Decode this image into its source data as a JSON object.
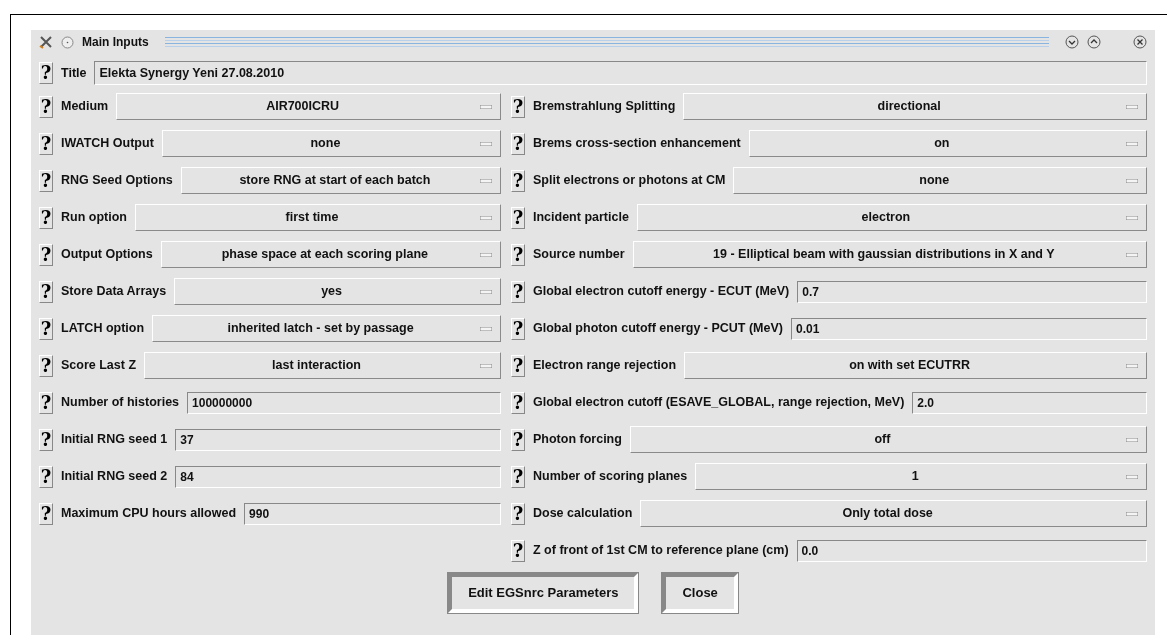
{
  "window": {
    "title": "Main Inputs"
  },
  "title_field": {
    "label": "Title",
    "value": "Elekta Synergy Yeni 27.08.2010"
  },
  "left_fields": [
    {
      "label": "Medium",
      "kind": "menu",
      "value": "AIR700ICRU"
    },
    {
      "label": "IWATCH Output",
      "kind": "menu",
      "value": "none"
    },
    {
      "label": "RNG Seed Options",
      "kind": "menu",
      "value": "store RNG at start of each batch"
    },
    {
      "label": "Run option",
      "kind": "menu",
      "value": "first time"
    },
    {
      "label": "Output Options",
      "kind": "menu",
      "value": "phase space at each scoring plane"
    },
    {
      "label": "Store Data Arrays",
      "kind": "menu",
      "value": "yes"
    },
    {
      "label": "LATCH option",
      "kind": "menu",
      "value": "inherited latch - set by passage"
    },
    {
      "label": "Score Last Z",
      "kind": "menu",
      "value": "last interaction"
    },
    {
      "label": "Number of histories",
      "kind": "entry",
      "value": "100000000"
    },
    {
      "label": "Initial RNG seed 1",
      "kind": "entry",
      "value": "37"
    },
    {
      "label": "Initial RNG seed 2",
      "kind": "entry",
      "value": "84"
    },
    {
      "label": "Maximum CPU hours allowed",
      "kind": "entry",
      "value": "990"
    }
  ],
  "right_fields": [
    {
      "label": "Bremstrahlung Splitting",
      "kind": "menu",
      "value": "directional"
    },
    {
      "label": "Brems cross-section enhancement",
      "kind": "menu",
      "value": "on"
    },
    {
      "label": "Split electrons or photons at CM",
      "kind": "menu",
      "value": "none"
    },
    {
      "label": "Incident particle",
      "kind": "menu",
      "value": "electron"
    },
    {
      "label": "Source number",
      "kind": "menu",
      "value": "19 - Elliptical beam with gaussian distributions in X and Y"
    },
    {
      "label": "Global electron cutoff energy - ECUT (MeV)",
      "kind": "entry",
      "value": "0.7"
    },
    {
      "label": "Global photon cutoff energy - PCUT (MeV)",
      "kind": "entry",
      "value": "0.01"
    },
    {
      "label": "Electron range rejection",
      "kind": "menu",
      "value": "on with set ECUTRR"
    },
    {
      "label": "Global electron cutoff (ESAVE_GLOBAL, range rejection, MeV)",
      "kind": "entry",
      "value": "2.0"
    },
    {
      "label": "Photon forcing",
      "kind": "menu",
      "value": "off"
    },
    {
      "label": "Number of scoring planes",
      "kind": "menu",
      "value": "1"
    },
    {
      "label": "Dose calculation",
      "kind": "menu",
      "value": "Only total dose"
    },
    {
      "label": "Z of front of 1st CM to reference plane (cm)",
      "kind": "entry",
      "value": "0.0"
    }
  ],
  "help_glyph": "?",
  "buttons": [
    "Edit EGSnrc Parameters",
    "Close"
  ]
}
